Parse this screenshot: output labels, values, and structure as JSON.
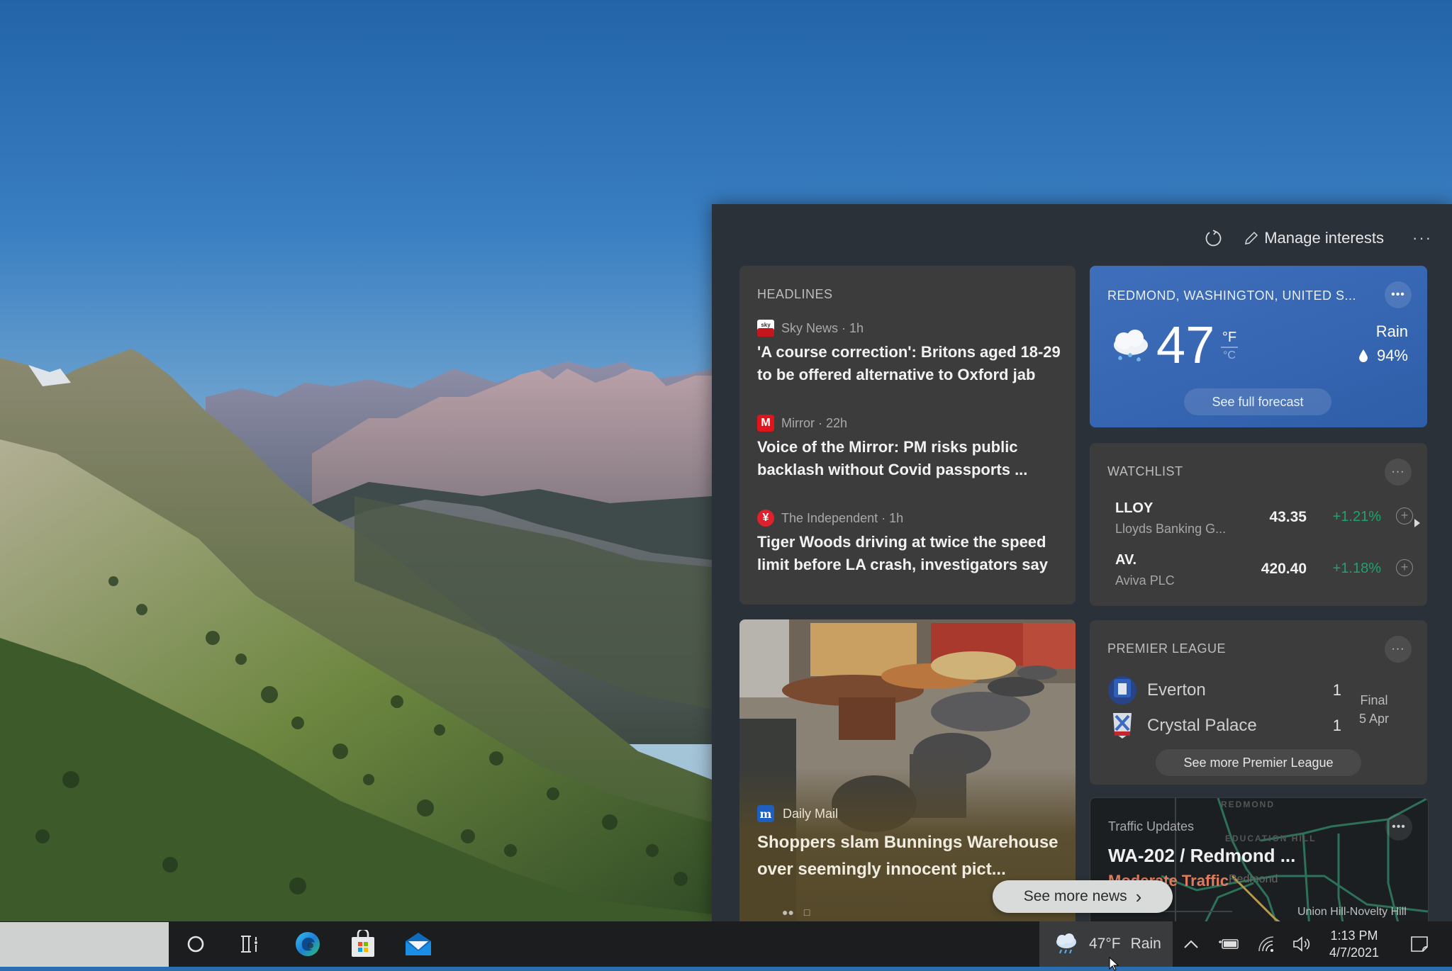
{
  "panel": {
    "header": {
      "refresh_icon": "refresh-icon",
      "manage_label": "Manage interests",
      "more_label": "···"
    },
    "headlines": {
      "title": "HEADLINES",
      "items": [
        {
          "source": "Sky News · 1h",
          "logo": "sky",
          "logo_color": "#c4161c",
          "title": "'A course correction': Britons aged 18-29 to be offered alternative to Oxford jab"
        },
        {
          "source": "Mirror · 22h",
          "logo": "M",
          "logo_color": "#e0141b",
          "title": "Voice of the Mirror: PM risks public backlash without Covid passports ..."
        },
        {
          "source": "The Independent · 1h",
          "logo": "¥",
          "logo_color": "#e0202a",
          "title": "Tiger Woods driving at twice the speed limit before LA crash, investigators say"
        }
      ]
    },
    "image_news": {
      "source": "Daily Mail",
      "logo": "m",
      "logo_color": "#1f5fbf",
      "title": "Shoppers slam Bunnings Warehouse over seemingly innocent pict..."
    },
    "weather": {
      "location": "REDMOND, WASHINGTON, UNITED S...",
      "temp": "47",
      "unit_f": "°F",
      "unit_c": "°C",
      "condition": "Rain",
      "precip": "94%",
      "forecast_label": "See full forecast",
      "more": "•••"
    },
    "watchlist": {
      "title": "WATCHLIST",
      "more": "···",
      "stocks": [
        {
          "symbol": "LLOY",
          "name": "Lloyds Banking G...",
          "price": "43.35",
          "change": "+1.21%"
        },
        {
          "symbol": "AV.",
          "name": "Aviva PLC",
          "price": "420.40",
          "change": "+1.18%"
        }
      ],
      "change_color": "#1fa36a"
    },
    "premier_league": {
      "title": "PREMIER LEAGUE",
      "more": "···",
      "teams": [
        {
          "name": "Everton",
          "score": "1"
        },
        {
          "name": "Crystal Palace",
          "score": "1"
        }
      ],
      "status": "Final",
      "date": "5 Apr",
      "more_label": "See more Premier League"
    },
    "traffic": {
      "title": "Traffic Updates",
      "road": "WA-202 / Redmond ...",
      "status": "Moderate Traffic",
      "status_color": "#e07c5e",
      "more": "•••",
      "map_labels": [
        "REDMOND",
        "EDUCATION HILL",
        "Redmond",
        "Union Hill-Novelty Hill"
      ]
    },
    "see_more_news": "See more news",
    "see_more_chevron": "›"
  },
  "taskbar": {
    "weather": {
      "temp": "47°F",
      "condition": "Rain"
    },
    "clock": {
      "time": "1:13 PM",
      "date": "4/7/2021"
    }
  }
}
